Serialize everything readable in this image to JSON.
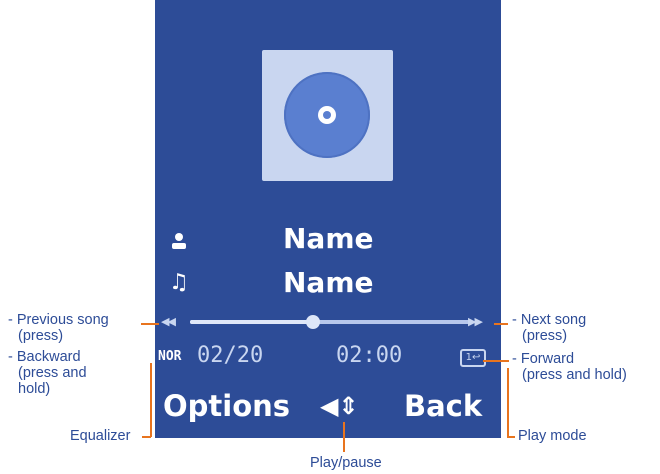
{
  "screen": {
    "artist_name": "Name",
    "track_name": "Name",
    "artist_icon": "person-icon",
    "track_icon": "music-note-icon",
    "progress": 0.44,
    "equalizer": "NOR",
    "track_position": "02/20",
    "time": "02:00",
    "softkeys": {
      "left": "Options",
      "right": "Back"
    },
    "prev_icon": "rewind-icon",
    "next_icon": "fast-forward-icon",
    "playmode_icon": "repeat-one-icon",
    "playpause_icon": "play-pause-icon",
    "colors": {
      "background": "#2d4c97",
      "album": "#c9d6f0",
      "callout_line": "#e8741e"
    }
  },
  "callouts": {
    "prev_song": [
      "- Previous song",
      "(press)"
    ],
    "backward": [
      "- Backward",
      "(press and",
      "hold)"
    ],
    "next_song": [
      "- Next song",
      "(press)"
    ],
    "forward": [
      "- Forward",
      "(press and hold)"
    ],
    "equalizer": "Equalizer",
    "play_mode": "Play mode",
    "play_pause": "Play/pause"
  }
}
